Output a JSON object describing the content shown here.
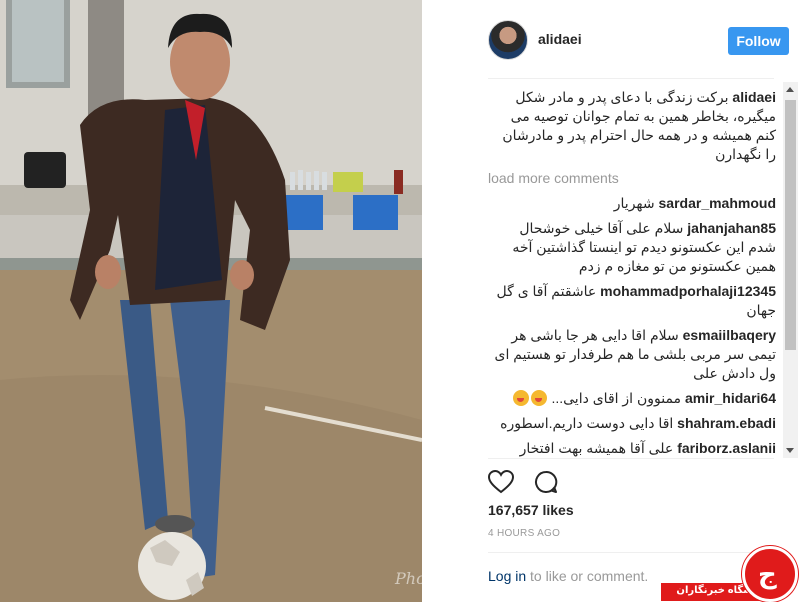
{
  "post": {
    "username": "alidaei",
    "follow_label": "Follow",
    "caption_user": "alidaei",
    "caption_text": "برکت زندگی با دعای پدر و مادر شکل میگیره، بخاطر همین به تمام جوانان توصیه می کنم همیشه و در همه حال احترام پدر و مادرشان را نگهدارن",
    "load_more": "load more comments",
    "likes": "167,657 likes",
    "time": "4 HOURS AGO",
    "login_link": "Log in",
    "login_rest": " to like or comment."
  },
  "comments": [
    {
      "user": "sardar_mahmoud",
      "text": "شهریار"
    },
    {
      "user": "jahanjahan85",
      "text": "سلام علی آقا خیلی خوشحال شدم این عکستونو دیدم تو اینستا گذاشتین آخه همین عکستونو من تو مغازه م زدم"
    },
    {
      "user": "mohammadporhalaji12345",
      "text": "عاشقتم آقا ی گل جهان"
    },
    {
      "user": "esmaiilbaqery",
      "text": "سلام اقا دایی هر جا باشی هر تیمی سر مربی بلشی ما هم طرفدار تو هستیم ای ول دادش علی"
    },
    {
      "user": "amir_hidari64",
      "text": "ممنوون از اقای دایی..."
    },
    {
      "user": "shahram.ebadi",
      "text": "اقا دایی دوست داریم.اسطوره"
    },
    {
      "user": "fariborz.aslanii",
      "text": "علی آقا همیشه بهت افتخار"
    }
  ],
  "icons": {
    "like": "heart-icon",
    "comment": "comment-bubble-icon",
    "emoji": "emoji-face-icon"
  },
  "badge": {
    "text": "باشگاه خبرنگاران"
  },
  "colors": {
    "follow_button": "#3897f0",
    "username_link": "#003569",
    "badge_red": "#e01b1b"
  }
}
